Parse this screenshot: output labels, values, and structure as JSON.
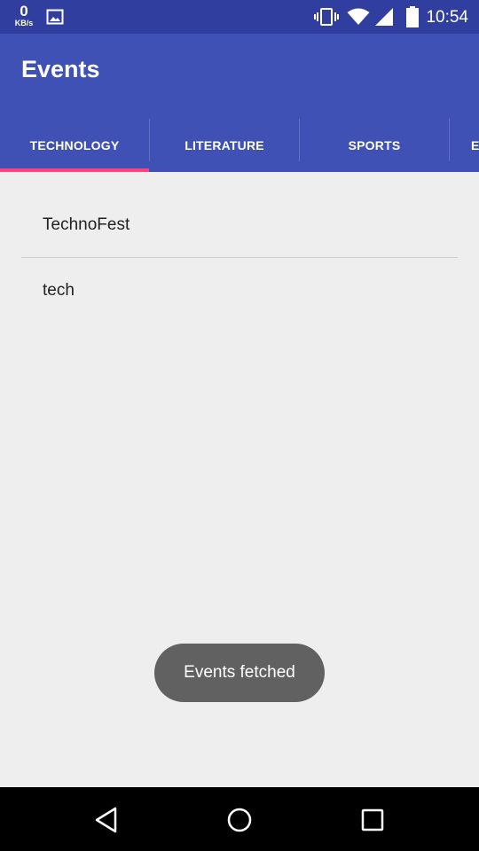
{
  "status_bar": {
    "speed_value": "0",
    "speed_unit": "KB/s",
    "time": "10:54",
    "icons": [
      "image-icon",
      "vibrate-icon",
      "wifi-icon",
      "signal-icon",
      "battery-icon"
    ]
  },
  "app_bar": {
    "title": "Events",
    "background": "#3f51b5",
    "status_background": "#303f9f"
  },
  "tabs": [
    {
      "label": "TECHNOLOGY",
      "selected": true
    },
    {
      "label": "LITERATURE",
      "selected": false
    },
    {
      "label": "SPORTS",
      "selected": false
    },
    {
      "label": "E",
      "selected": false
    }
  ],
  "tab_indicator_color": "#ff4081",
  "events": [
    {
      "name": "TechnoFest"
    },
    {
      "name": "tech"
    }
  ],
  "toast": {
    "message": "Events fetched"
  },
  "nav_bar": {
    "icons": [
      "back-icon",
      "home-icon",
      "recents-icon"
    ]
  }
}
